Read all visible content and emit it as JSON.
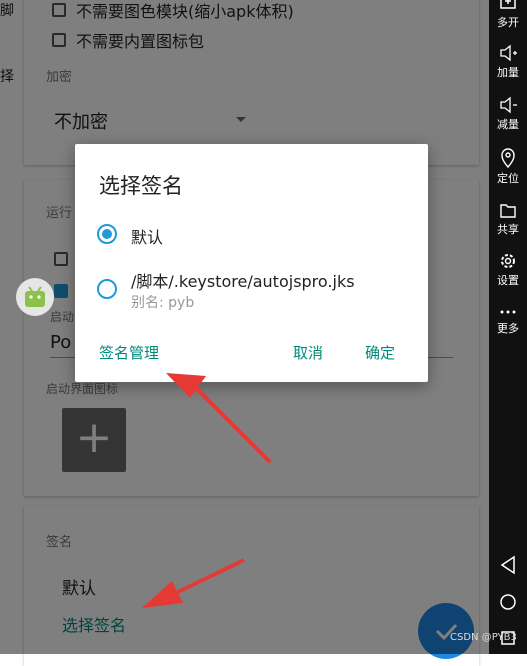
{
  "left_strip": {
    "char1": "脚",
    "char2": "择"
  },
  "options": {
    "no_color_module": "不需要图色模块(缩小apk体积)",
    "no_builtin_icons": "不需要内置图标包"
  },
  "encryption": {
    "label": "加密",
    "value": "不加密"
  },
  "run": {
    "label": "运行",
    "launch_label": "启动",
    "launch_value": "Po",
    "launch_icon_label": "启动界面图标",
    "add_symbol": "+"
  },
  "signature": {
    "label": "签名",
    "value": "默认",
    "choose_link": "选择签名"
  },
  "dialog": {
    "title": "选择签名",
    "options": [
      {
        "label": "默认",
        "selected": true
      },
      {
        "label": "/脚本/.keystore/autojspro.jks",
        "alias": "别名: pyb",
        "selected": false
      }
    ],
    "manage_button": "签名管理",
    "cancel_button": "取消",
    "confirm_button": "确定"
  },
  "sidebar": [
    {
      "icon": "multi-open-icon",
      "label": "多开"
    },
    {
      "icon": "volume-up-icon",
      "label": "加量"
    },
    {
      "icon": "volume-down-icon",
      "label": "减量"
    },
    {
      "icon": "location-icon",
      "label": "定位"
    },
    {
      "icon": "folder-icon",
      "label": "共享"
    },
    {
      "icon": "settings-icon",
      "label": "设置"
    },
    {
      "icon": "more-icon",
      "label": "更多"
    }
  ],
  "watermark": "CSDN @PYB3",
  "colors": {
    "accent": "#00897b",
    "radio": "#1e9ad6",
    "arrow": "#e53935",
    "fab": "#1e88e5"
  }
}
